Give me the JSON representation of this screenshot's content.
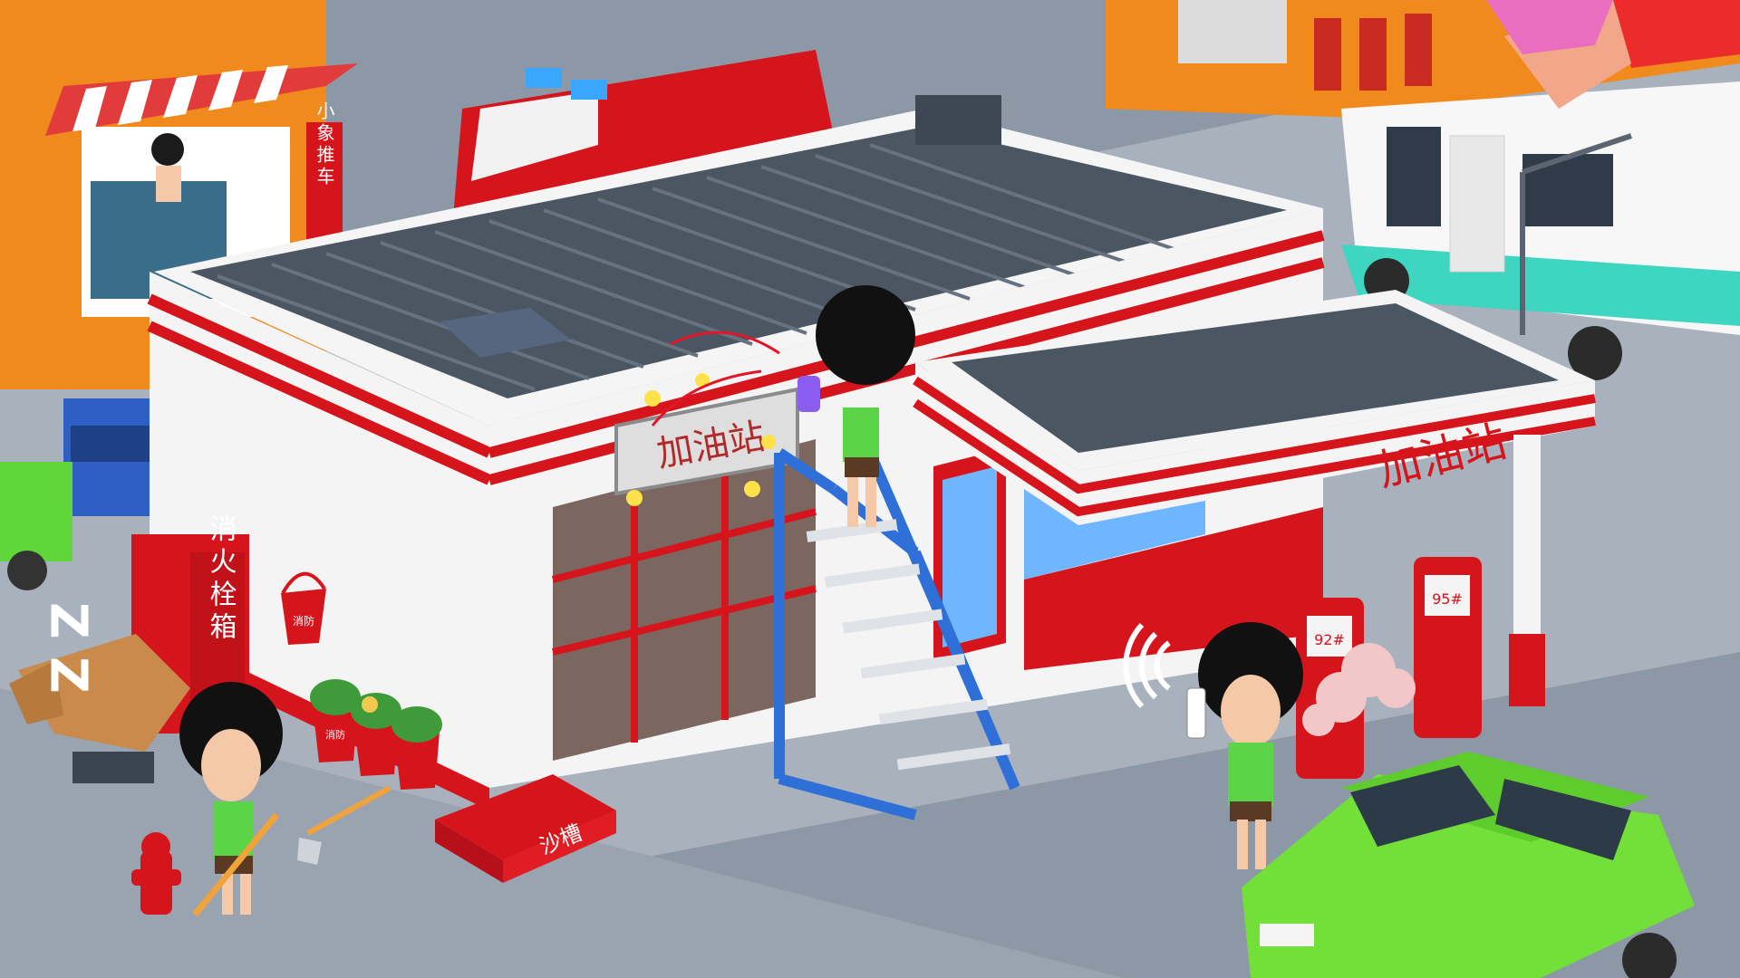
{
  "scene": {
    "station_roof_sign": "加油站",
    "canopy_sign": "加油站",
    "hydrant_cabinet_sign": "消火栓箱",
    "sand_trough_sign": "沙槽",
    "shop_vertical_sign": "小象推车",
    "sleep_symbol": "Z Z",
    "pump_left_grade": "92#",
    "pump_right_grade": "95#",
    "fire_bucket_label": "消防",
    "flower_pot_label": "消防",
    "icons": [
      "wifi-signal-icon",
      "sparkle-icon",
      "sleep-z-icon",
      "smoke-cloud-icon"
    ]
  },
  "colors": {
    "ground": "#8f9aa7",
    "sidewalk": "#a9b2bd",
    "station_red": "#d6141c",
    "station_white": "#f4f4f4",
    "roof_dark": "#4b5663",
    "ladder_blue": "#2f6fd8",
    "car_green": "#73e03a",
    "shop_orange": "#f08a1c",
    "awning_red": "#e23b3b"
  }
}
